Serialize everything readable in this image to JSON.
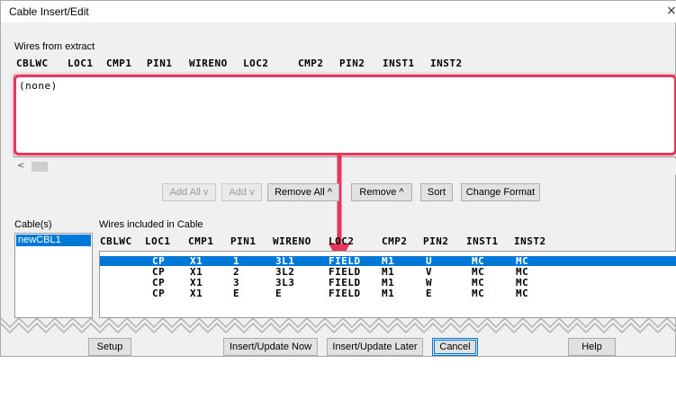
{
  "window": {
    "title": "Cable Insert/Edit",
    "close": "×"
  },
  "extract": {
    "label": "Wires from extract",
    "columns": [
      "CBLWC",
      "LOC1",
      "CMP1",
      "PIN1",
      "WIRENO",
      "LOC2",
      "CMP2",
      "PIN2",
      "INST1",
      "INST2"
    ],
    "content": "(none)"
  },
  "buttons": {
    "add_all": "Add All v",
    "add": "Add v",
    "remove_all": "Remove All ^",
    "remove": "Remove ^",
    "sort": "Sort",
    "change_format": "Change Format",
    "setup": "Setup",
    "insert_now": "Insert/Update Now",
    "insert_later": "Insert/Update Later",
    "cancel": "Cancel",
    "help": "Help"
  },
  "cables": {
    "label": "Cable(s)",
    "items": [
      "newCBL1"
    ]
  },
  "included": {
    "label": "Wires included in Cable",
    "columns": [
      "CBLWC",
      "LOC1",
      "CMP1",
      "PIN1",
      "WIRENO",
      "LOC2",
      "CMP2",
      "PIN2",
      "INST1",
      "INST2"
    ],
    "rows": [
      [
        "CP",
        "X1",
        "1",
        "3L1",
        "FIELD",
        "M1",
        "U",
        "MC",
        "MC"
      ],
      [
        "CP",
        "X1",
        "2",
        "3L2",
        "FIELD",
        "M1",
        "V",
        "MC",
        "MC"
      ],
      [
        "CP",
        "X1",
        "3",
        "3L3",
        "FIELD",
        "M1",
        "W",
        "MC",
        "MC"
      ],
      [
        "CP",
        "X1",
        "E",
        "E",
        "FIELD",
        "M1",
        "E",
        "MC",
        "MC"
      ]
    ]
  },
  "colors": {
    "highlight": "#e8365a",
    "selection": "#0078d7"
  }
}
